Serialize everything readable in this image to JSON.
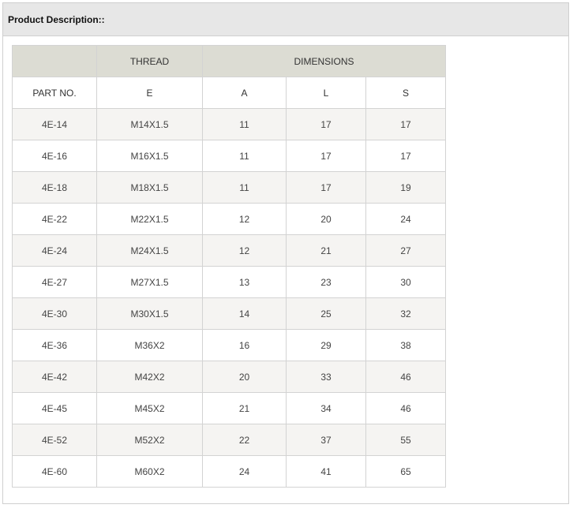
{
  "panel": {
    "title": "Product Description::"
  },
  "table": {
    "group_headers": {
      "blank": "",
      "thread": "THREAD",
      "dimensions": "DIMENSIONS"
    },
    "column_headers": [
      "PART NO.",
      "E",
      "A",
      "L",
      "S"
    ],
    "rows": [
      [
        "4E-14",
        "M14X1.5",
        "11",
        "17",
        "17"
      ],
      [
        "4E-16",
        "M16X1.5",
        "11",
        "17",
        "17"
      ],
      [
        "4E-18",
        "M18X1.5",
        "11",
        "17",
        "19"
      ],
      [
        "4E-22",
        "M22X1.5",
        "12",
        "20",
        "24"
      ],
      [
        "4E-24",
        "M24X1.5",
        "12",
        "21",
        "27"
      ],
      [
        "4E-27",
        "M27X1.5",
        "13",
        "23",
        "30"
      ],
      [
        "4E-30",
        "M30X1.5",
        "14",
        "25",
        "32"
      ],
      [
        "4E-36",
        "M36X2",
        "16",
        "29",
        "38"
      ],
      [
        "4E-42",
        "M42X2",
        "20",
        "33",
        "46"
      ],
      [
        "4E-45",
        "M45X2",
        "21",
        "34",
        "46"
      ],
      [
        "4E-52",
        "M52X2",
        "22",
        "37",
        "55"
      ],
      [
        "4E-60",
        "M60X2",
        "24",
        "41",
        "65"
      ]
    ]
  }
}
